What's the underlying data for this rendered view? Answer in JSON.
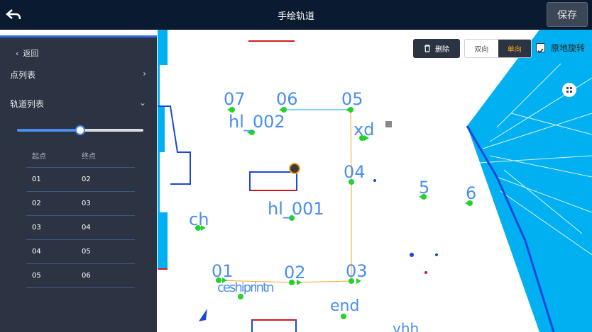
{
  "header": {
    "title": "手绘轨道",
    "save_label": "保存"
  },
  "toolbar": {
    "delete_label": "删除",
    "bidirectional_label": "双向",
    "unidirectional_label": "单向",
    "rotate_in_place_label": "原地旋转"
  },
  "panel": {
    "back_label": "返回",
    "point_list_label": "点列表",
    "track_list_label": "轨道列表",
    "slider_value": 0.5,
    "table": {
      "headers": [
        "起点",
        "终点"
      ],
      "rows": [
        [
          "01",
          "02"
        ],
        [
          "02",
          "03"
        ],
        [
          "03",
          "04"
        ],
        [
          "04",
          "05"
        ],
        [
          "05",
          "06"
        ]
      ]
    }
  },
  "map": {
    "labels": [
      "07",
      "06",
      "05",
      "hl_002",
      "xd",
      "04",
      "5",
      "6",
      "ch",
      "hl_001",
      "01",
      "02",
      "03",
      "ceshiprintn",
      "end",
      "yhh"
    ]
  },
  "colors": {
    "topbar": "#0a1a30",
    "panel": "#2c3443",
    "accent": "#f5a623",
    "map_blue": "#00b0f0",
    "point_green": "#22d32a",
    "label_blue": "#4a8ef0"
  }
}
